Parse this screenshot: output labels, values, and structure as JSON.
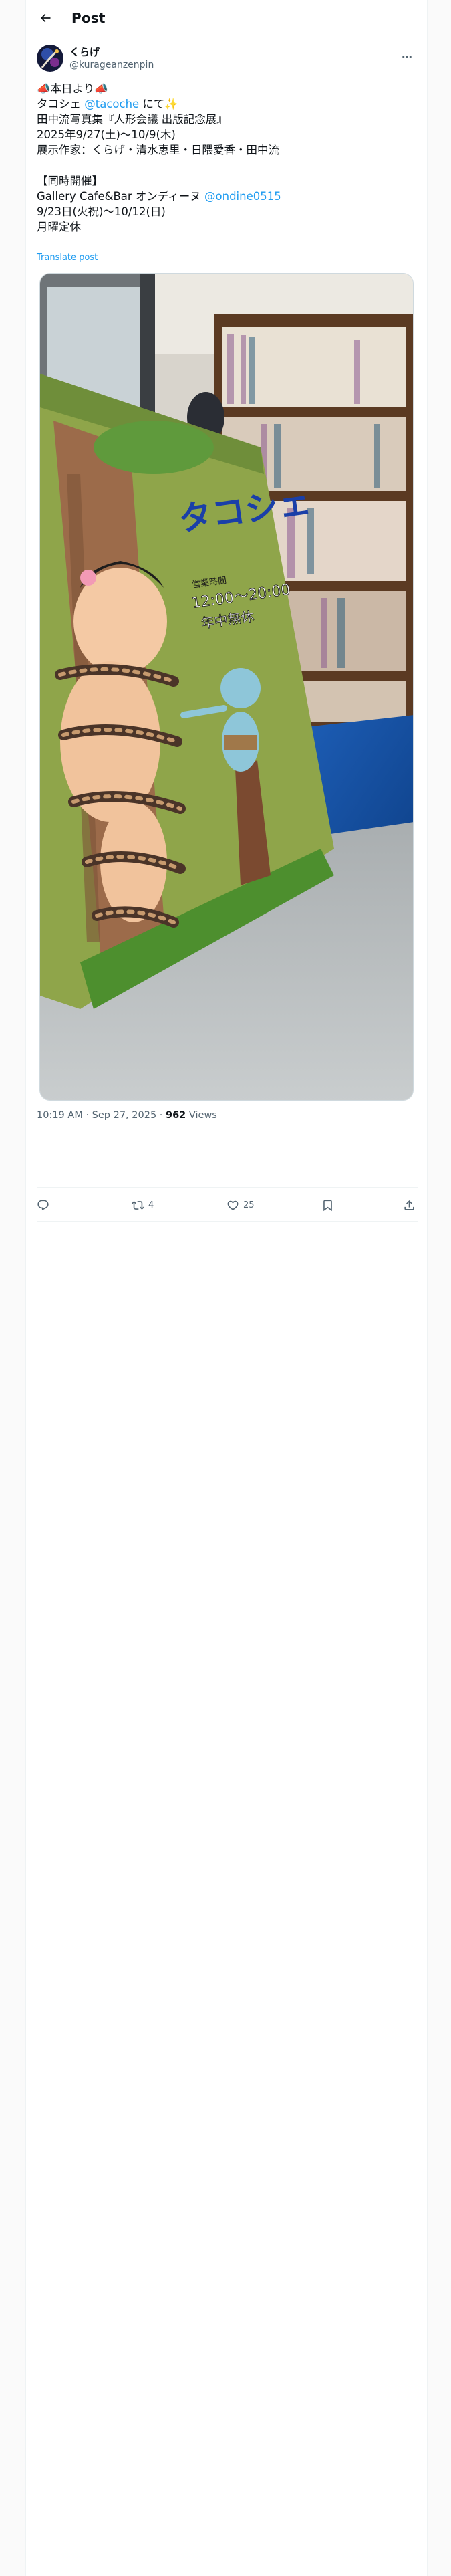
{
  "header": {
    "title": "Post",
    "back_icon": "arrow-left-icon"
  },
  "author": {
    "display_name": "くらげ",
    "handle": "@kurageanzenpin",
    "avatar_icon": "avatar-image",
    "more_icon": "more-horizontal-icon"
  },
  "tweet": {
    "line1_prefix": "📣本日より📣",
    "line2_a": "タコシェ ",
    "line2_mention": "@tacoche",
    "line2_b": " にて✨",
    "line3": "田中流写真集『人形会議 出版記念展』",
    "line4": "2025年9/27(土)〜10/9(木)",
    "line5": "展示作家：くらげ・清水恵里・日隈愛香・田中流",
    "line6": "",
    "line7": "【同時開催】",
    "line8_a": "Gallery Cafe&Bar オンディーヌ ",
    "line8_mention": "@ondine0515",
    "line9": "9/23日(火祝)〜10/12(日)",
    "line10": "月曜定休",
    "translate_label": "Translate post"
  },
  "photo": {
    "sign_text": "タコシェ",
    "sign_subtext": "12:00〜20:00",
    "sign_subtext2": "年中無休",
    "sign_small": "営業時間"
  },
  "meta": {
    "time": "10:19 AM",
    "date": "Sep 27, 2025",
    "separator": "·",
    "views_count": "962",
    "views_label": "Views"
  },
  "actions": {
    "reply_count": "",
    "repost_count": "4",
    "like_count": "25",
    "bookmark_count": "",
    "reply_icon": "reply-icon",
    "repost_icon": "repost-icon",
    "like_icon": "heart-icon",
    "bookmark_icon": "bookmark-icon",
    "share_icon": "share-icon"
  },
  "colors": {
    "link": "#1d9bf0",
    "secondary_text": "#536471",
    "border": "#eff3f4"
  }
}
